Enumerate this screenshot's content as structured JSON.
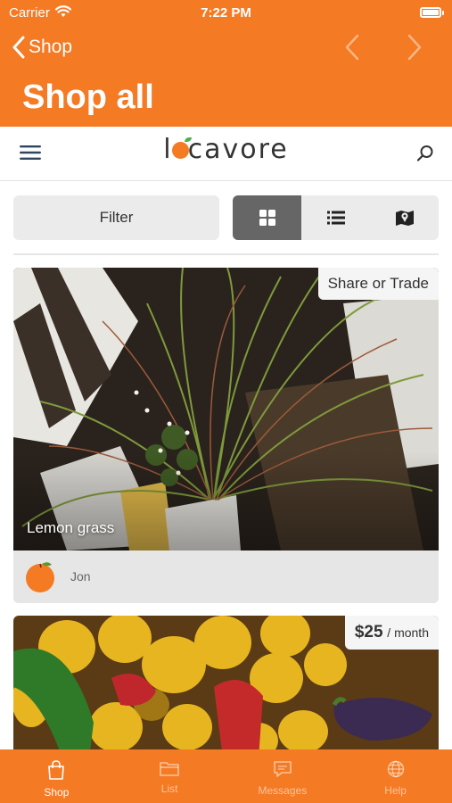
{
  "status_bar": {
    "carrier": "Carrier",
    "time": "7:22 PM",
    "battery_level": 1.0
  },
  "nav": {
    "back_label": "Shop",
    "title": "Shop all"
  },
  "brand": {
    "logo_text": "locavore",
    "logo_color": "#f47a24"
  },
  "toolbar": {
    "filter_label": "Filter",
    "view_modes": [
      {
        "icon": "grid-icon",
        "selected": true
      },
      {
        "icon": "list-icon",
        "selected": false
      },
      {
        "icon": "map-icon",
        "selected": false
      }
    ]
  },
  "listings": [
    {
      "title": "Lemon grass",
      "badge": "Share or Trade",
      "owner": "Jon"
    },
    {
      "price": "$25",
      "price_unit": "/ month"
    }
  ],
  "tabbar": {
    "tabs": [
      {
        "label": "Shop",
        "icon": "bag-icon",
        "active": true
      },
      {
        "label": "List",
        "icon": "folder-icon",
        "active": false
      },
      {
        "label": "Messages",
        "icon": "chat-icon",
        "active": false
      },
      {
        "label": "Help",
        "icon": "globe-icon",
        "active": false
      }
    ]
  },
  "colors": {
    "accent": "#f47a24",
    "tab_inactive": "#ffd9b8"
  }
}
